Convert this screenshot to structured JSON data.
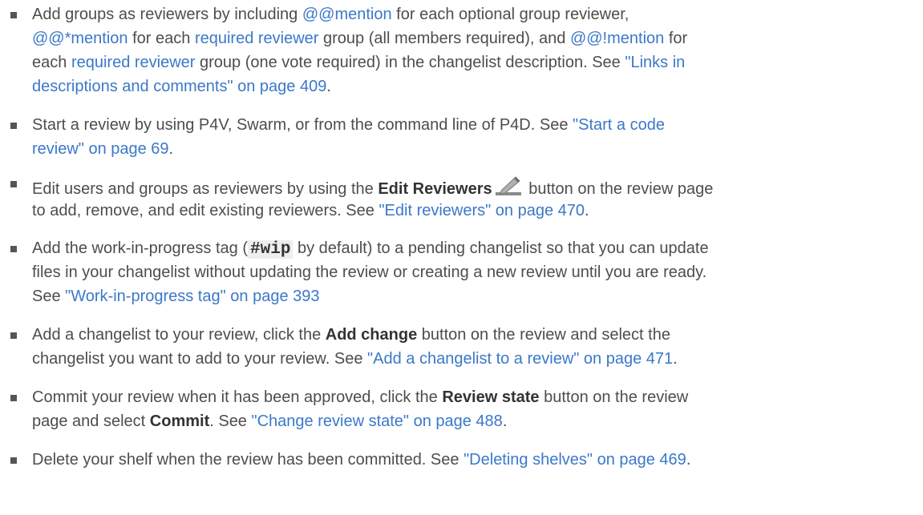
{
  "items": [
    {
      "lines": [
        [
          {
            "t": "Add groups as reviewers by including ",
            "s": "text"
          },
          {
            "t": "@@mention",
            "s": "link"
          },
          {
            "t": " for each optional group reviewer,",
            "s": "text"
          }
        ],
        [
          {
            "t": "@@*mention",
            "s": "link"
          },
          {
            "t": " for each ",
            "s": "text"
          },
          {
            "t": "required reviewer",
            "s": "link"
          },
          {
            "t": " group (all members required), and ",
            "s": "text"
          },
          {
            "t": "@@!mention",
            "s": "link"
          },
          {
            "t": " for",
            "s": "text"
          }
        ],
        [
          {
            "t": "each ",
            "s": "text"
          },
          {
            "t": "required reviewer",
            "s": "link"
          },
          {
            "t": " group (one vote required) in the changelist description. See ",
            "s": "text"
          },
          {
            "t": "\"Links in",
            "s": "link"
          }
        ],
        [
          {
            "t": "descriptions and comments\" on page 409",
            "s": "link"
          },
          {
            "t": ".",
            "s": "text"
          }
        ]
      ]
    },
    {
      "lines": [
        [
          {
            "t": "Start a review by using P4V, Swarm, or from the command line of P4D. See ",
            "s": "text"
          },
          {
            "t": "\"Start a code",
            "s": "link"
          }
        ],
        [
          {
            "t": "review\" on page 69",
            "s": "link"
          },
          {
            "t": ".",
            "s": "text"
          }
        ]
      ]
    },
    {
      "lines": [
        [
          {
            "t": "Edit users and groups as reviewers by using the ",
            "s": "text"
          },
          {
            "t": "Edit Reviewers",
            "s": "bold"
          },
          {
            "t": "pencil-icon",
            "s": "icon"
          },
          {
            "t": " button on the review page",
            "s": "text"
          }
        ],
        [
          {
            "t": "to add, remove, and edit existing reviewers. See ",
            "s": "text"
          },
          {
            "t": "\"Edit reviewers\" on page 470",
            "s": "link"
          },
          {
            "t": ".",
            "s": "text"
          }
        ]
      ]
    },
    {
      "lines": [
        [
          {
            "t": "Add the work-in-progress tag (",
            "s": "text"
          },
          {
            "t": "#wip",
            "s": "code"
          },
          {
            "t": " by default) to a pending changelist so that you can update",
            "s": "text"
          }
        ],
        [
          {
            "t": "files in your changelist without updating the review or creating a new review until you are ready.",
            "s": "text"
          }
        ],
        [
          {
            "t": "See ",
            "s": "text"
          },
          {
            "t": "\"Work-in-progress tag\" on page 393",
            "s": "link"
          }
        ]
      ]
    },
    {
      "lines": [
        [
          {
            "t": "Add a changelist to your review, click the ",
            "s": "text"
          },
          {
            "t": "Add change",
            "s": "bold"
          },
          {
            "t": " button on the review and select the",
            "s": "text"
          }
        ],
        [
          {
            "t": "changelist you want to add to your review. See ",
            "s": "text"
          },
          {
            "t": "\"Add a changelist to a review\" on page 471",
            "s": "link"
          },
          {
            "t": ".",
            "s": "text"
          }
        ]
      ]
    },
    {
      "lines": [
        [
          {
            "t": "Commit your review when it has been approved, click the ",
            "s": "text"
          },
          {
            "t": "Review state",
            "s": "bold"
          },
          {
            "t": " button on the review",
            "s": "text"
          }
        ],
        [
          {
            "t": "page and select ",
            "s": "text"
          },
          {
            "t": "Commit",
            "s": "bold"
          },
          {
            "t": ". See ",
            "s": "text"
          },
          {
            "t": "\"Change review state\" on page 488",
            "s": "link"
          },
          {
            "t": ".",
            "s": "text"
          }
        ]
      ]
    },
    {
      "lines": [
        [
          {
            "t": "Delete your shelf when the review has been committed. See ",
            "s": "text"
          },
          {
            "t": "\"Deleting shelves\" on page 469",
            "s": "link"
          },
          {
            "t": ".",
            "s": "text"
          }
        ]
      ]
    }
  ]
}
